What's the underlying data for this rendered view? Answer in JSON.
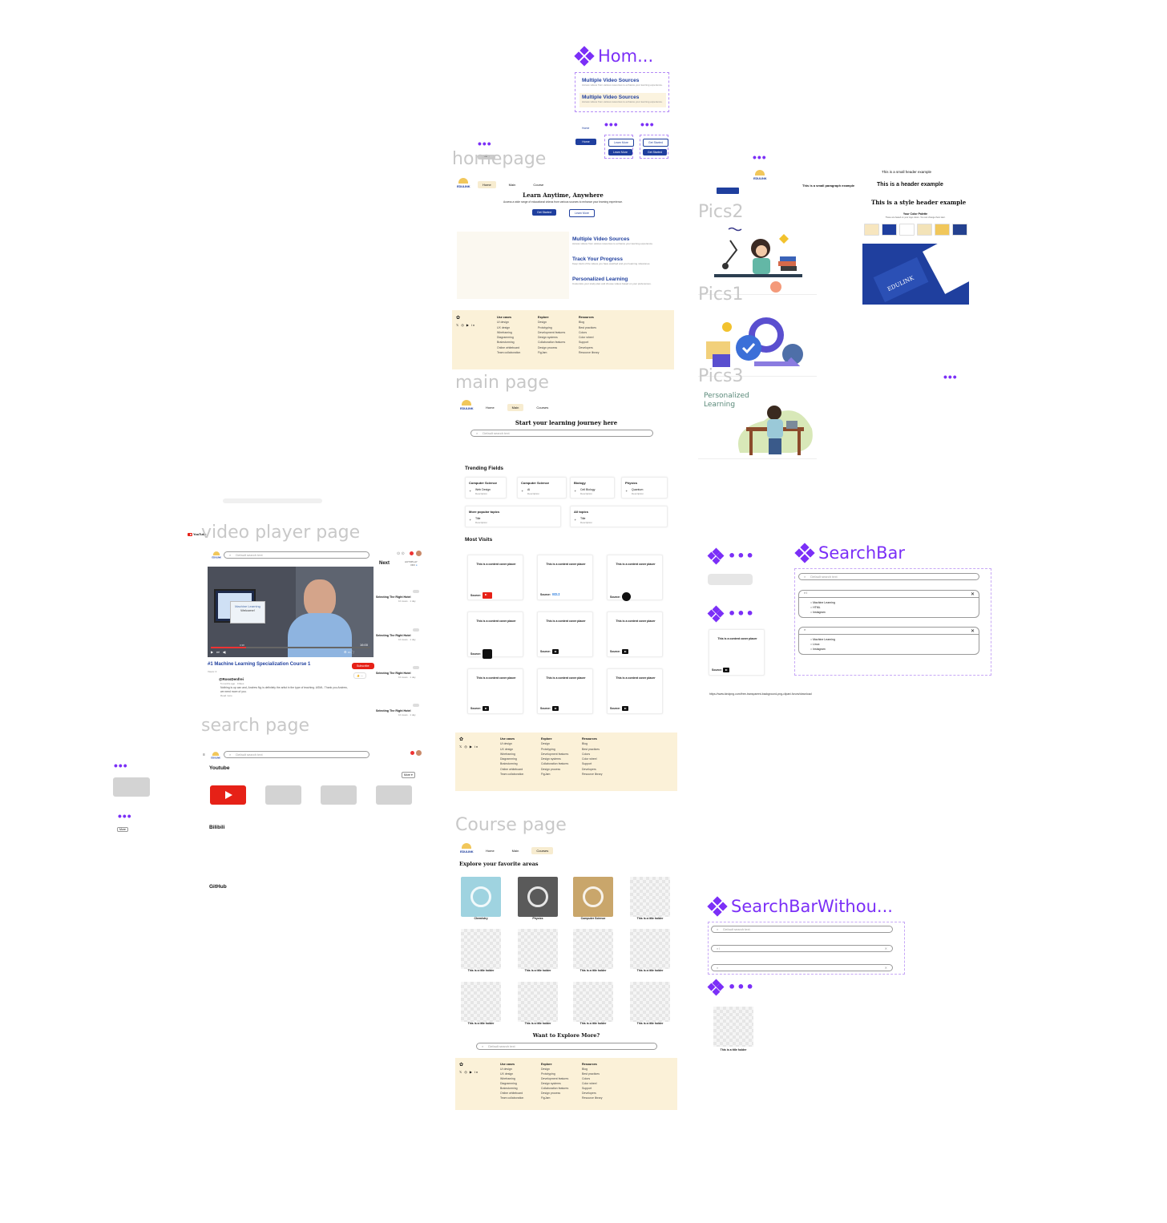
{
  "canvas": {
    "frames": {
      "home_comp": "Hom...",
      "homepage": "homepage",
      "main_page": "main page",
      "video_player_page": "video player page",
      "search_page": "search page",
      "course_page": "Course page",
      "pics1": "Pics1",
      "pics2": "Pics2",
      "pics3": "Pics3",
      "searchbar": "SearchBar",
      "searchbar_without": "SearchBarWithou..."
    },
    "ellipsis": "•••",
    "link_url": "https://www.kindpng.com/free-transparent-background-png-clipart-forum/download"
  },
  "home_comp": {
    "title": "Multiple Video Sources",
    "desc": "Access videos from various resources to enhance your learning experience.",
    "home_label": "Home",
    "learn_more": "Learn More",
    "get_started": "Get Started"
  },
  "nav": {
    "home": "Home",
    "main": "Main",
    "courses": "Course",
    "courses2": "Courses",
    "menu": "Menu"
  },
  "logo": "EDULINK",
  "homepage": {
    "hero_title": "Learn Anytime, Anywhere",
    "hero_sub": "Access a wide range of educational videos from various sources to enhance your learning experience.",
    "get_started": "Get Started",
    "learn_more": "Learn More",
    "features": [
      {
        "title": "Multiple Video Sources",
        "desc": "Access videos from various resources to enhance your learning experience."
      },
      {
        "title": "Track Your Progress",
        "desc": "Keep track of the videos you have watched and your learning milestones."
      },
      {
        "title": "Personalized Learning",
        "desc": "Customize your study plan and choose videos based on your preferences."
      }
    ]
  },
  "footer": {
    "cols": [
      {
        "head": "Use cases",
        "items": [
          "UI design",
          "UX design",
          "Wireframing",
          "Diagramming",
          "Brainstorming",
          "Online whiteboard",
          "Team collaboration"
        ]
      },
      {
        "head": "Explore",
        "items": [
          "Design",
          "Prototyping",
          "Development features",
          "Design systems",
          "Collaboration features",
          "Design process",
          "FigJam"
        ]
      },
      {
        "head": "Resources",
        "items": [
          "Blog",
          "Best practices",
          "Colors",
          "Color wheel",
          "Support",
          "Developers",
          "Resource library"
        ]
      }
    ]
  },
  "main": {
    "heading": "Start your learning journey here",
    "search_placeholder": "Default search text",
    "trending": "Trending Fields",
    "fields": [
      {
        "title": "Computer Science",
        "item": "Web Design",
        "sub": "Description"
      },
      {
        "title": "Computer Science",
        "item": "AI",
        "sub": "Description"
      },
      {
        "title": "Biology",
        "item": "Cell Biology",
        "sub": "Description"
      },
      {
        "title": "Physics",
        "item": "Quantum",
        "sub": "Description"
      },
      {
        "title": "More popular topics",
        "item": "Title",
        "sub": "Description"
      },
      {
        "title": "All topics",
        "item": "Title",
        "sub": "Description"
      }
    ],
    "most_visits": "Most Visits",
    "cover_text": "This is a content cover placer",
    "source_label": "Source:"
  },
  "video": {
    "yt_label": "YouTube",
    "search_placeholder": "Default search text",
    "next": "Next",
    "autoplay": "AUTOPLAY",
    "autoplay_state": "OFF",
    "slide_title": "Machine Learning",
    "slide_sub": "Welcome!",
    "title": "#1 Machine Learning Specialization Course 1",
    "subscribe": "Subscribe",
    "channel_views": "Views: 0",
    "commenter": "@RossDenfrei",
    "comment_meta": "5 months ago · 0 likes",
    "comment": "Nothing is up can and, Andrew Ng is definitely the artist in the type of teaching. ASML. Thank you Andrew, we need more of you.",
    "read_more": "Read more",
    "time_cur": "0:38",
    "time_total": "16:00",
    "up_next": [
      {
        "title": "Selecting The Right Hotel",
        "meta": "10 views · 1 day"
      },
      {
        "title": "Selecting The Right Hotel",
        "meta": "10 views · 1 day"
      },
      {
        "title": "Selecting The Right Hotel",
        "meta": "10 views · 1 day"
      },
      {
        "title": "Selecting The Right Hotel",
        "meta": "10 views · 1 day"
      }
    ]
  },
  "search_page": {
    "search_placeholder": "Default search text",
    "youtube": "Youtube",
    "more": "More",
    "bilibili": "Bilibili",
    "github": "GitHub",
    "more_small": "More"
  },
  "course": {
    "heading": "Explore your favorite areas",
    "cards": [
      "Chemistry",
      "Physics",
      "Computer Science",
      "This is a title holder",
      "This is a title holder",
      "This is a title holder",
      "This is a title holder",
      "This is a title holder",
      "This is a title holder",
      "This is a title holder",
      "This is a title holder",
      "This is a title holder"
    ],
    "explore_more": "Want to Explore More?",
    "search_placeholder": "Default search text"
  },
  "style": {
    "small_header": "This is a small header example",
    "paragraph": "This is a small paragraph example",
    "header": "This is a header example",
    "style_header": "This is a style header example",
    "palette_title": "Your Color Palette",
    "palette_sub": "These are based on your logo colors. You can change them later.",
    "palette": [
      "#f7e6bf",
      "#1f3f9e",
      "#ffffff",
      "#f3e3b8",
      "#f1c75b",
      "#24418f"
    ]
  },
  "pics3": {
    "caption": "Personalized Learning"
  },
  "searchbar": {
    "placeholder": "Default search text",
    "typed": "l",
    "results1": [
      "Machine Learning",
      "HTML",
      "Instagram"
    ],
    "results2": [
      "Machine Learning",
      "Linux",
      "Instagram"
    ]
  },
  "small_card": {
    "text": "This is a content cover placer",
    "source": "Source:"
  },
  "title_holder": "This is a title holder"
}
